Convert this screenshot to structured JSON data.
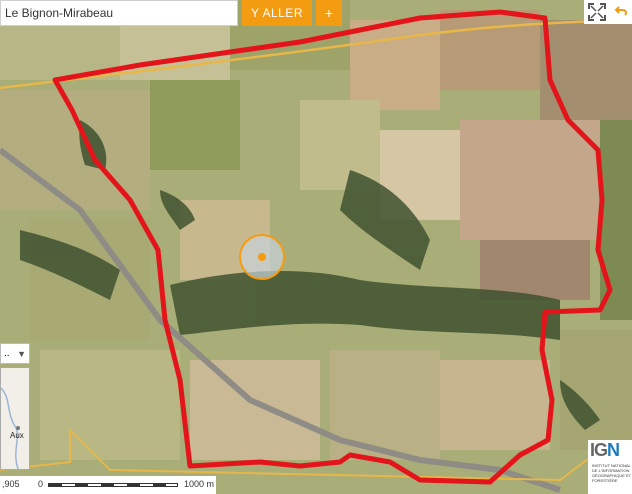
{
  "search": {
    "value": "Le Bignon-Mirabeau"
  },
  "go_button": {
    "label": "Y ALLER"
  },
  "add_button": {
    "label": "+"
  },
  "tools": {
    "fullscreen_icon": "fullscreen-icon",
    "back_icon": "undo-arrow-icon"
  },
  "layer_selector": {
    "value": "..",
    "icon": "triangle-down-icon"
  },
  "minimap": {
    "label": "Aux"
  },
  "scale": {
    "coord": ",905",
    "zero": "0",
    "max": "1000 m"
  },
  "logo": {
    "letters_a": "IG",
    "letters_b": "N",
    "subtitle": "INSTITUT NATIONAL DE L'INFORMATION GÉOGRAPHIQUE ET FORESTIÈRE"
  },
  "colors": {
    "accent": "#f39c12",
    "boundary": "#e4141b",
    "marker": "#f39c12"
  }
}
